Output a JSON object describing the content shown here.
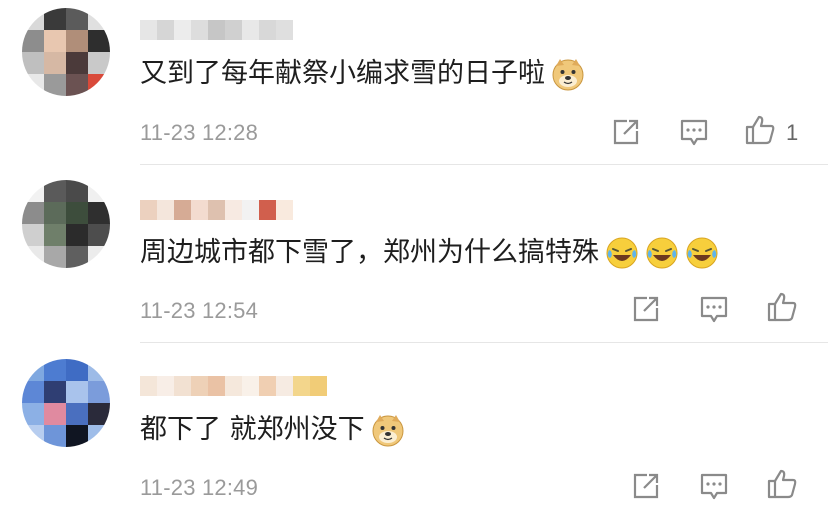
{
  "comments": [
    {
      "text": "又到了每年献祭小编求雪的日子啦",
      "emojis": [
        "doge-emoji"
      ],
      "time": "11-23 12:28",
      "like_count": "1"
    },
    {
      "text": "周边城市都下雪了，郑州为什么搞特殊",
      "emojis": [
        "laugh-cry-emoji",
        "laugh-cry-emoji",
        "laugh-cry-emoji"
      ],
      "time": "11-23 12:54",
      "like_count": ""
    },
    {
      "text": "都下了 就郑州没下",
      "emojis": [
        "doge-emoji"
      ],
      "time": "11-23 12:49",
      "like_count": ""
    }
  ],
  "icons": {
    "share": "share-icon",
    "reply": "comment-icon",
    "like": "thumbs-up-icon"
  },
  "colors": {
    "text": "#1e1e1e",
    "meta": "#9a9a9a",
    "icon": "#8a8a8a",
    "divider": "#e6e6e6"
  }
}
